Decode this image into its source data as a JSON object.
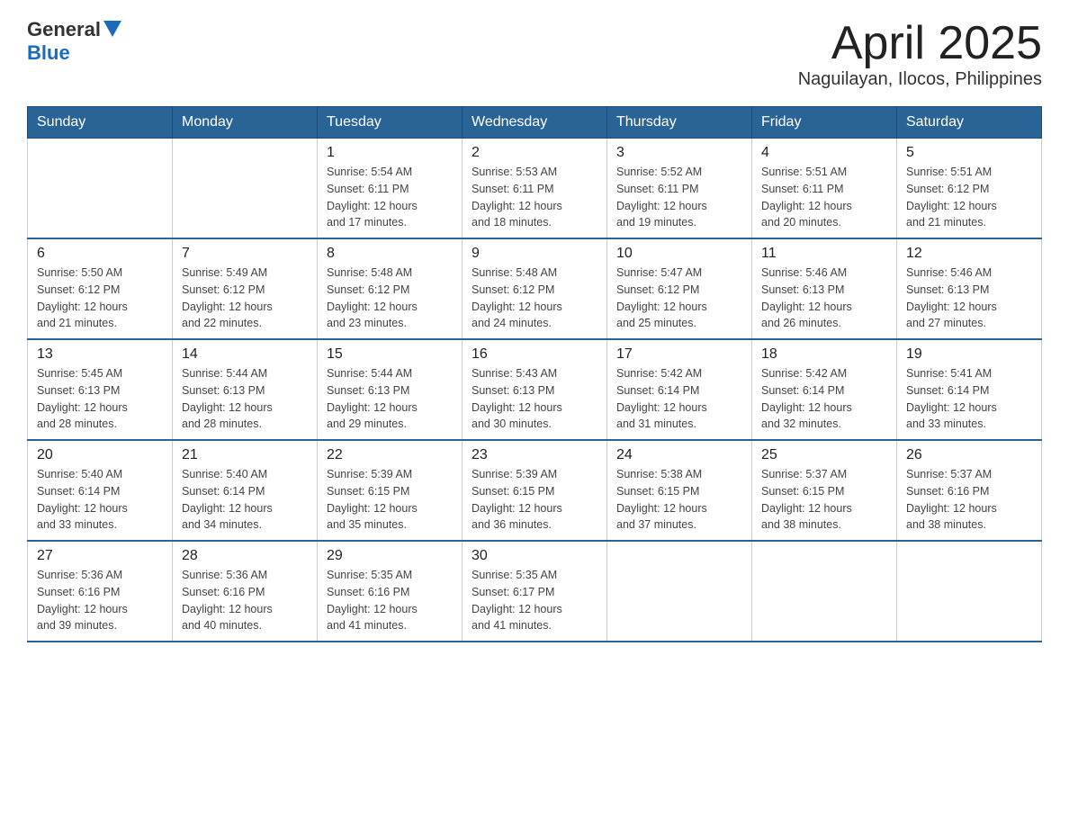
{
  "header": {
    "logo": {
      "general": "General",
      "blue": "Blue"
    },
    "title": "April 2025",
    "subtitle": "Naguilayan, Ilocos, Philippines"
  },
  "weekdays": [
    "Sunday",
    "Monday",
    "Tuesday",
    "Wednesday",
    "Thursday",
    "Friday",
    "Saturday"
  ],
  "weeks": [
    [
      {
        "day": "",
        "info": ""
      },
      {
        "day": "",
        "info": ""
      },
      {
        "day": "1",
        "info": "Sunrise: 5:54 AM\nSunset: 6:11 PM\nDaylight: 12 hours\nand 17 minutes."
      },
      {
        "day": "2",
        "info": "Sunrise: 5:53 AM\nSunset: 6:11 PM\nDaylight: 12 hours\nand 18 minutes."
      },
      {
        "day": "3",
        "info": "Sunrise: 5:52 AM\nSunset: 6:11 PM\nDaylight: 12 hours\nand 19 minutes."
      },
      {
        "day": "4",
        "info": "Sunrise: 5:51 AM\nSunset: 6:11 PM\nDaylight: 12 hours\nand 20 minutes."
      },
      {
        "day": "5",
        "info": "Sunrise: 5:51 AM\nSunset: 6:12 PM\nDaylight: 12 hours\nand 21 minutes."
      }
    ],
    [
      {
        "day": "6",
        "info": "Sunrise: 5:50 AM\nSunset: 6:12 PM\nDaylight: 12 hours\nand 21 minutes."
      },
      {
        "day": "7",
        "info": "Sunrise: 5:49 AM\nSunset: 6:12 PM\nDaylight: 12 hours\nand 22 minutes."
      },
      {
        "day": "8",
        "info": "Sunrise: 5:48 AM\nSunset: 6:12 PM\nDaylight: 12 hours\nand 23 minutes."
      },
      {
        "day": "9",
        "info": "Sunrise: 5:48 AM\nSunset: 6:12 PM\nDaylight: 12 hours\nand 24 minutes."
      },
      {
        "day": "10",
        "info": "Sunrise: 5:47 AM\nSunset: 6:12 PM\nDaylight: 12 hours\nand 25 minutes."
      },
      {
        "day": "11",
        "info": "Sunrise: 5:46 AM\nSunset: 6:13 PM\nDaylight: 12 hours\nand 26 minutes."
      },
      {
        "day": "12",
        "info": "Sunrise: 5:46 AM\nSunset: 6:13 PM\nDaylight: 12 hours\nand 27 minutes."
      }
    ],
    [
      {
        "day": "13",
        "info": "Sunrise: 5:45 AM\nSunset: 6:13 PM\nDaylight: 12 hours\nand 28 minutes."
      },
      {
        "day": "14",
        "info": "Sunrise: 5:44 AM\nSunset: 6:13 PM\nDaylight: 12 hours\nand 28 minutes."
      },
      {
        "day": "15",
        "info": "Sunrise: 5:44 AM\nSunset: 6:13 PM\nDaylight: 12 hours\nand 29 minutes."
      },
      {
        "day": "16",
        "info": "Sunrise: 5:43 AM\nSunset: 6:13 PM\nDaylight: 12 hours\nand 30 minutes."
      },
      {
        "day": "17",
        "info": "Sunrise: 5:42 AM\nSunset: 6:14 PM\nDaylight: 12 hours\nand 31 minutes."
      },
      {
        "day": "18",
        "info": "Sunrise: 5:42 AM\nSunset: 6:14 PM\nDaylight: 12 hours\nand 32 minutes."
      },
      {
        "day": "19",
        "info": "Sunrise: 5:41 AM\nSunset: 6:14 PM\nDaylight: 12 hours\nand 33 minutes."
      }
    ],
    [
      {
        "day": "20",
        "info": "Sunrise: 5:40 AM\nSunset: 6:14 PM\nDaylight: 12 hours\nand 33 minutes."
      },
      {
        "day": "21",
        "info": "Sunrise: 5:40 AM\nSunset: 6:14 PM\nDaylight: 12 hours\nand 34 minutes."
      },
      {
        "day": "22",
        "info": "Sunrise: 5:39 AM\nSunset: 6:15 PM\nDaylight: 12 hours\nand 35 minutes."
      },
      {
        "day": "23",
        "info": "Sunrise: 5:39 AM\nSunset: 6:15 PM\nDaylight: 12 hours\nand 36 minutes."
      },
      {
        "day": "24",
        "info": "Sunrise: 5:38 AM\nSunset: 6:15 PM\nDaylight: 12 hours\nand 37 minutes."
      },
      {
        "day": "25",
        "info": "Sunrise: 5:37 AM\nSunset: 6:15 PM\nDaylight: 12 hours\nand 38 minutes."
      },
      {
        "day": "26",
        "info": "Sunrise: 5:37 AM\nSunset: 6:16 PM\nDaylight: 12 hours\nand 38 minutes."
      }
    ],
    [
      {
        "day": "27",
        "info": "Sunrise: 5:36 AM\nSunset: 6:16 PM\nDaylight: 12 hours\nand 39 minutes."
      },
      {
        "day": "28",
        "info": "Sunrise: 5:36 AM\nSunset: 6:16 PM\nDaylight: 12 hours\nand 40 minutes."
      },
      {
        "day": "29",
        "info": "Sunrise: 5:35 AM\nSunset: 6:16 PM\nDaylight: 12 hours\nand 41 minutes."
      },
      {
        "day": "30",
        "info": "Sunrise: 5:35 AM\nSunset: 6:17 PM\nDaylight: 12 hours\nand 41 minutes."
      },
      {
        "day": "",
        "info": ""
      },
      {
        "day": "",
        "info": ""
      },
      {
        "day": "",
        "info": ""
      }
    ]
  ]
}
